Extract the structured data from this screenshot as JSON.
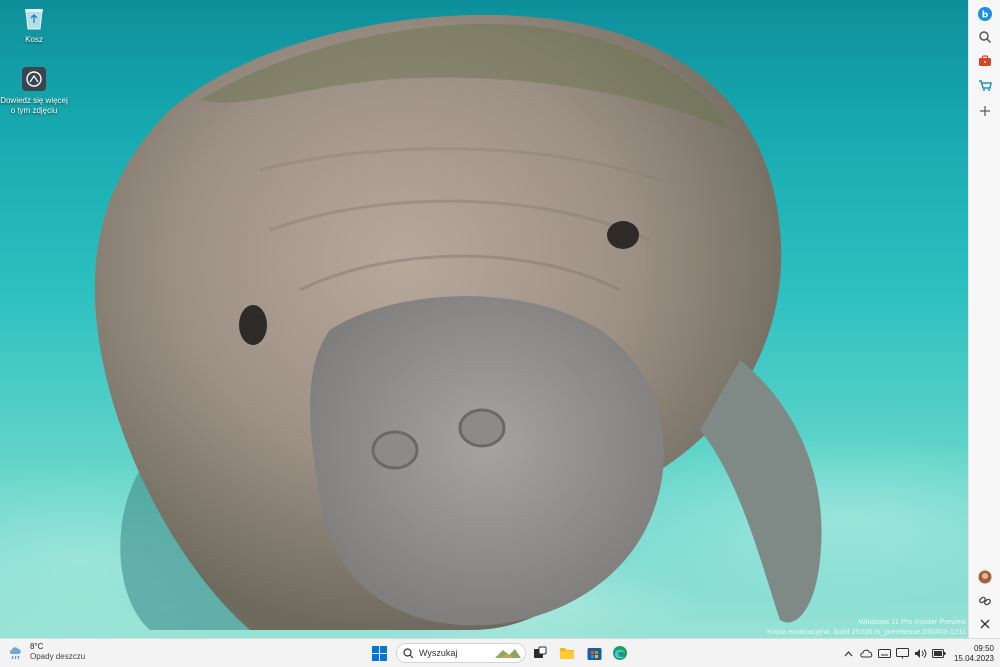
{
  "desktop": {
    "icons": [
      {
        "label": "Kosz",
        "icon": "recycle-bin-icon"
      },
      {
        "label": "Dowiedz się więcej o tym zdjęciu",
        "icon": "learn-more-icon"
      }
    ],
    "watermark": {
      "line1": "Windows 11 Pro Insider Preview",
      "line2": "Kopia ewaluacyjna. build 25336.rs_prerelease.230403-1211"
    }
  },
  "sidebar": {
    "items": [
      {
        "name": "bing-icon"
      },
      {
        "name": "search-icon"
      },
      {
        "name": "tools-icon"
      },
      {
        "name": "shopping-icon"
      },
      {
        "name": "add-icon"
      },
      {
        "name": "avatar"
      },
      {
        "name": "link-icon"
      },
      {
        "name": "close-icon"
      }
    ]
  },
  "taskbar": {
    "weather": {
      "temp": "8°C",
      "condition": "Opady deszczu"
    },
    "search": {
      "placeholder": "Wyszukaj"
    },
    "clock": {
      "time": "09:50",
      "date": "15.04.2023"
    }
  },
  "colors": {
    "taskbar_bg": "#f3f3f3",
    "start_blue": "#0078d4",
    "water": "#2ab8bf"
  }
}
